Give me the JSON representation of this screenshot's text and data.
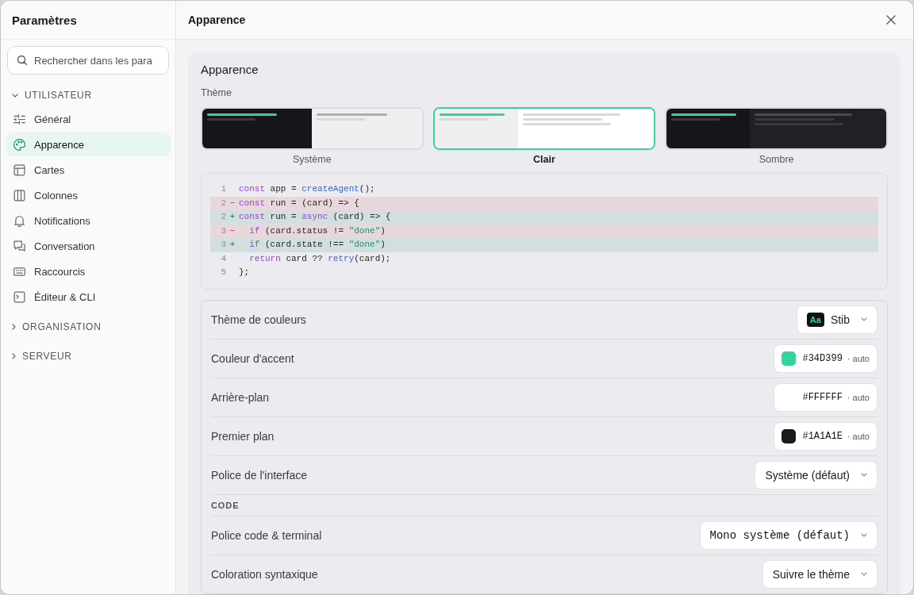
{
  "sidebar": {
    "title": "Paramètres",
    "search": {
      "placeholder": "Rechercher dans les para"
    },
    "sections": [
      {
        "label": "UTILISATEUR",
        "expanded": true,
        "items": [
          {
            "label": "Général",
            "selected": false
          },
          {
            "label": "Apparence",
            "selected": true
          },
          {
            "label": "Cartes",
            "selected": false
          },
          {
            "label": "Colonnes",
            "selected": false
          },
          {
            "label": "Notifications",
            "selected": false
          },
          {
            "label": "Conversation",
            "selected": false
          },
          {
            "label": "Raccourcis",
            "selected": false
          },
          {
            "label": "Éditeur & CLI",
            "selected": false
          }
        ]
      },
      {
        "label": "ORGANISATION",
        "expanded": false
      },
      {
        "label": "SERVEUR",
        "expanded": false
      }
    ]
  },
  "header": {
    "title": "Apparence"
  },
  "card": {
    "title": "Apparence",
    "theme_label": "Thème",
    "themes": [
      {
        "kind": "system",
        "label": "Système",
        "selected": false
      },
      {
        "kind": "light",
        "label": "Clair",
        "selected": true
      },
      {
        "kind": "dark",
        "label": "Sombre",
        "selected": false
      }
    ],
    "code_preview": {
      "lines": [
        {
          "number": "1",
          "kind": "context",
          "tokens": [
            {
              "kind": "keyword",
              "text": "const"
            },
            {
              "kind": "plain",
              "text": " app = "
            },
            {
              "kind": "function",
              "text": "createAgent"
            },
            {
              "kind": "plain",
              "text": "();"
            }
          ]
        },
        {
          "number": "2",
          "kind": "removed",
          "sign": "−",
          "tokens": [
            {
              "kind": "keyword",
              "text": "const"
            },
            {
              "kind": "plain",
              "text": " run = (card) => {"
            }
          ]
        },
        {
          "number": "2",
          "kind": "added",
          "sign": "+",
          "tokens": [
            {
              "kind": "keyword",
              "text": "const"
            },
            {
              "kind": "plain",
              "text": " run = "
            },
            {
              "kind": "keyword",
              "text": "async"
            },
            {
              "kind": "plain",
              "text": " (card) => {"
            }
          ]
        },
        {
          "number": "3",
          "kind": "removed",
          "sign": "−",
          "tokens": [
            {
              "kind": "keyword",
              "text": "  if"
            },
            {
              "kind": "plain",
              "text": " (card.status != "
            },
            {
              "kind": "string",
              "text": "\"done\""
            },
            {
              "kind": "plain",
              "text": ")"
            }
          ]
        },
        {
          "number": "3",
          "kind": "added",
          "sign": "+",
          "tokens": [
            {
              "kind": "keyword",
              "text": "  if"
            },
            {
              "kind": "plain",
              "text": " (card.state !== "
            },
            {
              "kind": "string",
              "text": "\"done\""
            },
            {
              "kind": "plain",
              "text": ")"
            }
          ]
        },
        {
          "number": "4",
          "kind": "context",
          "tokens": [
            {
              "kind": "keyword",
              "text": "  return"
            },
            {
              "kind": "plain",
              "text": " card ?? "
            },
            {
              "kind": "function",
              "text": "retry"
            },
            {
              "kind": "plain",
              "text": "(card);"
            }
          ]
        },
        {
          "number": "5",
          "kind": "context",
          "tokens": [
            {
              "kind": "plain",
              "text": "};"
            }
          ]
        }
      ]
    },
    "settings": {
      "rows": [
        {
          "kind": "select",
          "label": "Thème de couleurs",
          "badge": "Aa",
          "value": "Stib",
          "mono": false
        },
        {
          "kind": "color",
          "label": "Couleur d'accent",
          "color": "#34d399",
          "value": "#34D399",
          "note": "· auto"
        },
        {
          "kind": "color",
          "label": "Arrière-plan",
          "value": "#FFFFFF",
          "note": "· auto"
        },
        {
          "kind": "color",
          "label": "Premier plan",
          "color": "#1a1a1e",
          "value": "#1A1A1E",
          "note": "· auto"
        },
        {
          "kind": "select",
          "label": "Police de l'interface",
          "value": "Système (défaut)",
          "mono": false
        },
        {
          "kind": "heading",
          "label": "CODE"
        },
        {
          "kind": "select",
          "label": "Police code & terminal",
          "value": "Mono système (défaut)",
          "mono": true
        },
        {
          "kind": "select",
          "label": "Coloration syntaxique",
          "value": "Suivre le thème",
          "mono": false
        }
      ]
    }
  }
}
